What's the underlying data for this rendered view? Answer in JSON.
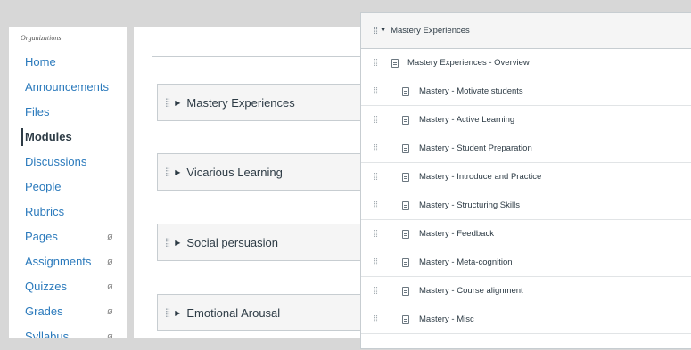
{
  "left_nav": {
    "org_label": "Organizations",
    "items": [
      {
        "label": "Home",
        "active": false,
        "hidden": false
      },
      {
        "label": "Announcements",
        "active": false,
        "hidden": false
      },
      {
        "label": "Files",
        "active": false,
        "hidden": false
      },
      {
        "label": "Modules",
        "active": true,
        "hidden": false
      },
      {
        "label": "Discussions",
        "active": false,
        "hidden": false
      },
      {
        "label": "People",
        "active": false,
        "hidden": false
      },
      {
        "label": "Rubrics",
        "active": false,
        "hidden": false
      },
      {
        "label": "Pages",
        "active": false,
        "hidden": true
      },
      {
        "label": "Assignments",
        "active": false,
        "hidden": true
      },
      {
        "label": "Quizzes",
        "active": false,
        "hidden": true
      },
      {
        "label": "Grades",
        "active": false,
        "hidden": true
      },
      {
        "label": "Syllabus",
        "active": false,
        "hidden": true
      }
    ]
  },
  "modules": [
    {
      "title": "Mastery Experiences"
    },
    {
      "title": "Vicarious Learning"
    },
    {
      "title": "Social persuasion"
    },
    {
      "title": "Emotional Arousal"
    }
  ],
  "module_detail": {
    "title": "Mastery Experiences",
    "items": [
      {
        "title": "Mastery Experiences - Overview",
        "indented": false
      },
      {
        "title": "Mastery - Motivate students",
        "indented": true
      },
      {
        "title": "Mastery - Active Learning",
        "indented": true
      },
      {
        "title": "Mastery - Student Preparation",
        "indented": true
      },
      {
        "title": "Mastery - Introduce and Practice",
        "indented": true
      },
      {
        "title": "Mastery - Structuring Skills",
        "indented": true
      },
      {
        "title": "Mastery - Feedback",
        "indented": true
      },
      {
        "title": "Mastery - Meta-cognition",
        "indented": true
      },
      {
        "title": "Mastery - Course alignment",
        "indented": true
      },
      {
        "title": "Mastery - Misc",
        "indented": true
      }
    ]
  },
  "icons": {
    "grip": "drag-handle-icon",
    "expand": "triangle-right-icon",
    "collapse": "triangle-down-icon",
    "hidden": "eye-slash-icon",
    "page": "page-icon"
  }
}
